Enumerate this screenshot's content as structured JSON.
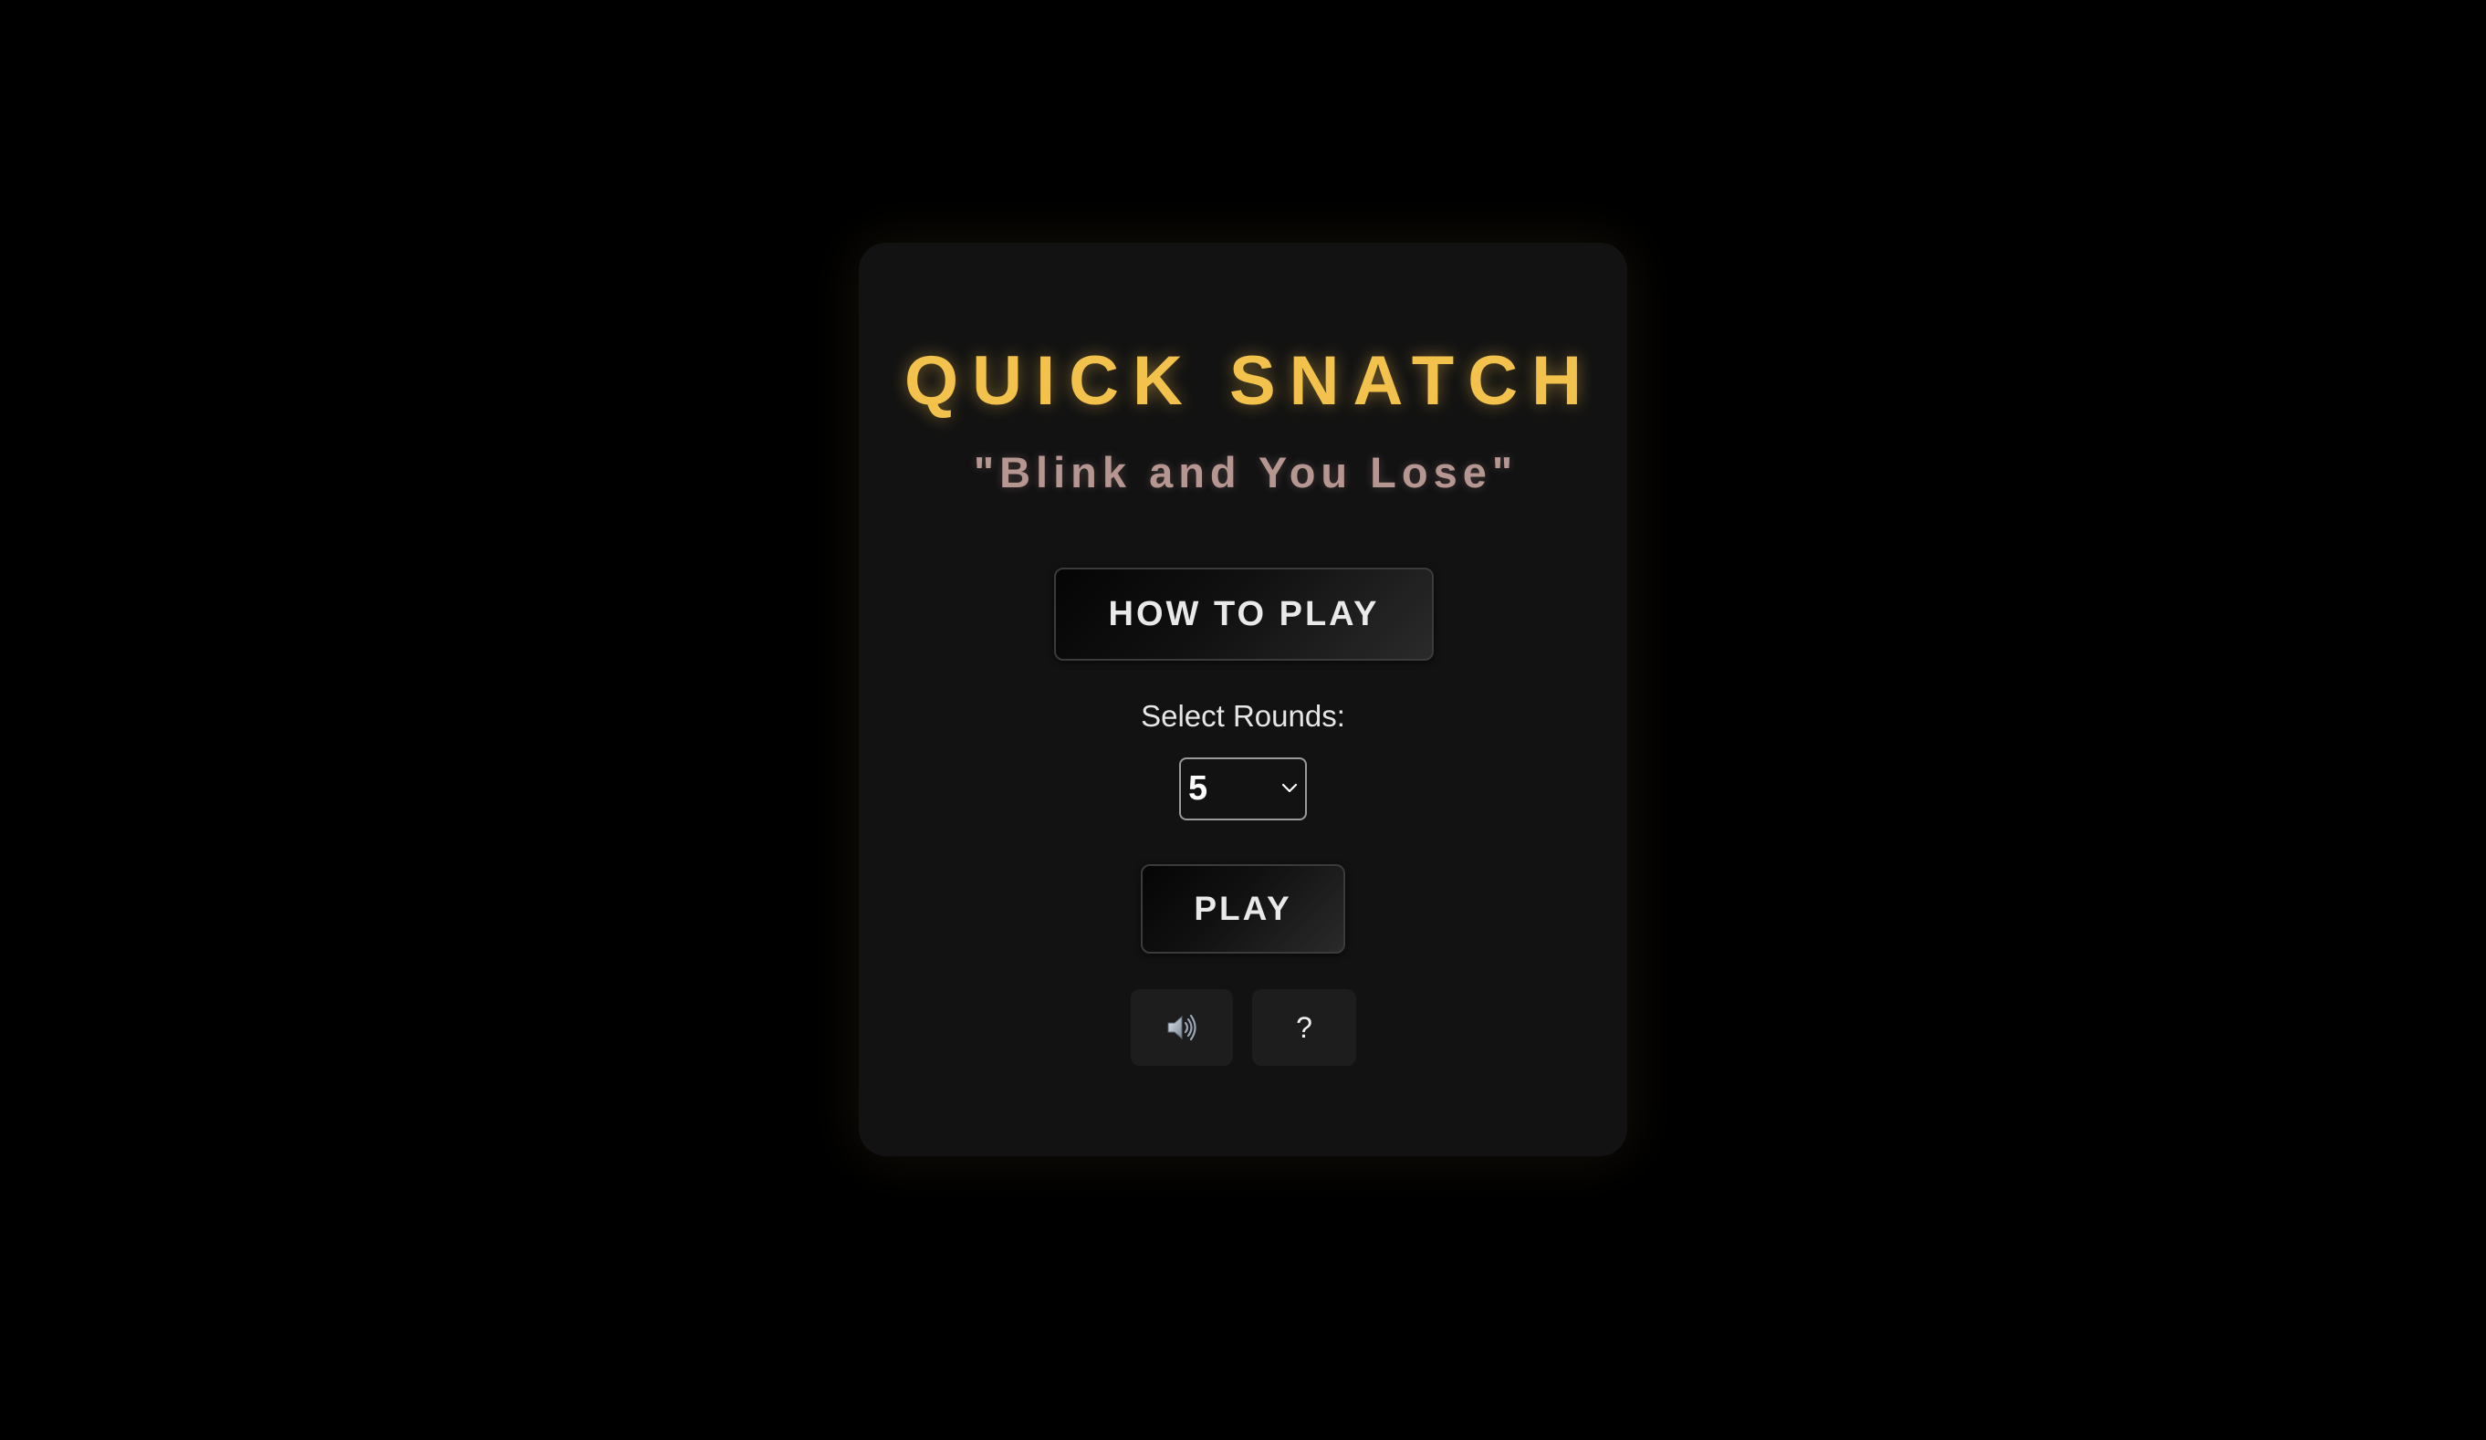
{
  "game": {
    "title": "QUICK SNATCH",
    "subtitle": "\"Blink and You Lose\"",
    "how_to_play_label": "HOW TO PLAY",
    "select_rounds_label": "Select Rounds:",
    "rounds_selected": "5",
    "play_label": "PLAY",
    "sound_icon": "speaker-icon",
    "help_label": "?"
  },
  "colors": {
    "background": "#000000",
    "panel": "#121212",
    "title": "#f2c24d",
    "subtitle": "#b69691",
    "button_text": "#e9e9e9"
  }
}
